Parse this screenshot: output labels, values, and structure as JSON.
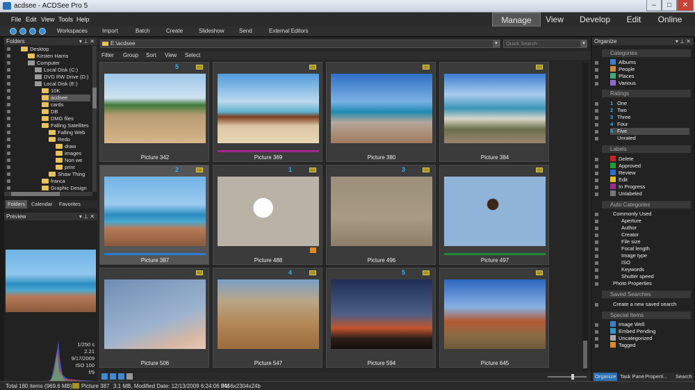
{
  "window": {
    "title": "acdsee - ACDSee Pro 5",
    "min": "–",
    "max": "□",
    "close": "✕"
  },
  "menu": [
    "File",
    "Edit",
    "View",
    "Tools",
    "Help"
  ],
  "modes": [
    "Manage",
    "View",
    "Develop",
    "Edit",
    "Online"
  ],
  "toolbar": [
    "Workspaces",
    "Import",
    "Batch",
    "Create",
    "Slideshow",
    "Send",
    "External Editors"
  ],
  "left": {
    "folders_title": "Folders",
    "tree": [
      {
        "label": "Desktop",
        "indent": 0,
        "type": "folder"
      },
      {
        "label": "Kirsten Harris",
        "indent": 1,
        "type": "folder"
      },
      {
        "label": "Computer",
        "indent": 1,
        "type": "drive"
      },
      {
        "label": "Local Disk (C:)",
        "indent": 2,
        "type": "drive"
      },
      {
        "label": "DVD RW Drive (D:)",
        "indent": 2,
        "type": "drive"
      },
      {
        "label": "Local Disk (E:)",
        "indent": 2,
        "type": "drive"
      },
      {
        "label": "10K",
        "indent": 3,
        "type": "folder"
      },
      {
        "label": "acdsee",
        "indent": 3,
        "type": "folder"
      },
      {
        "label": "cards",
        "indent": 3,
        "type": "folder"
      },
      {
        "label": "DB",
        "indent": 3,
        "type": "folder"
      },
      {
        "label": "DMG files",
        "indent": 3,
        "type": "folder"
      },
      {
        "label": "Falling Satellites",
        "indent": 3,
        "type": "folder"
      },
      {
        "label": "Falling Web",
        "indent": 4,
        "type": "folder"
      },
      {
        "label": "Redo",
        "indent": 4,
        "type": "folder"
      },
      {
        "label": "draw",
        "indent": 5,
        "type": "folder"
      },
      {
        "label": "images",
        "indent": 5,
        "type": "folder"
      },
      {
        "label": "Non we",
        "indent": 5,
        "type": "folder"
      },
      {
        "label": "print",
        "indent": 5,
        "type": "folder"
      },
      {
        "label": "Shaw Thing",
        "indent": 4,
        "type": "folder"
      },
      {
        "label": "franca",
        "indent": 3,
        "type": "folder"
      },
      {
        "label": "Graphic Design",
        "indent": 3,
        "type": "folder"
      }
    ],
    "tabs": [
      "Folders",
      "Calendar",
      "Favorites"
    ],
    "preview_title": "Preview",
    "exif": [
      "1/250 s",
      "2.21",
      "9/17/2009",
      "ISO 100",
      "f/9"
    ]
  },
  "center": {
    "path": "E:\\acdsee",
    "search_placeholder": "Quick Search",
    "filterbar": [
      "Filter",
      "Group",
      "Sort",
      "View",
      "Select"
    ],
    "thumbs": [
      {
        "caption": "Picture 342",
        "rating": "5",
        "bg": "linear-gradient(180deg,#9cc7ea 0%,#cfe2f1 35%,#3f7a3a 45%,#b99c73 60%,#d6b689 100%)",
        "color": ""
      },
      {
        "caption": "Picture 369",
        "rating": "",
        "bg": "linear-gradient(180deg,#4f9bdc 0%,#bcd9ef 40%,#5fb0cf 55%,#7a3e1f 62%,#dbc5a3 75%,#e8d6b5 100%)",
        "color": "#a0288f"
      },
      {
        "caption": "Picture 380",
        "rating": "",
        "bg": "linear-gradient(180deg,#2f6fc6 0%,#7ab1e3 40%,#1f8ab3 55%,#b4a79a 70%,#a07a5a 100%)",
        "color": ""
      },
      {
        "caption": "Picture 384",
        "rating": "",
        "bg": "linear-gradient(180deg,#3b7dd0 0%,#a9cbed 30%,#3a96b8 50%,#d9d4c6 65%,#6a6e4a 80%,#9a8670 100%)",
        "color": ""
      },
      {
        "caption": "Picture 387",
        "rating": "2",
        "bg": "linear-gradient(180deg,#6fb3e6 0%,#9ccbef 40%,#2a8cc0 55%,#4aa8cf 65%,#b77a57 75%,#8a5a3b 100%)",
        "color": "#2c7cd3",
        "sel": true
      },
      {
        "caption": "Picture 488",
        "rating": "1",
        "bg": "radial-gradient(circle at 45% 45%,#ffffff 0 14%,#b9b2a6 15% 100%)",
        "color": "",
        "tag": true
      },
      {
        "caption": "Picture 496",
        "rating": "3",
        "bg": "linear-gradient(180deg,#9c8f7b 0%,#a89a84 60%,#8c7e69 100%)",
        "color": ""
      },
      {
        "caption": "Picture 497",
        "rating": "",
        "bg": "radial-gradient(circle at 48% 40%,#3a2718 0 8%,#8fb4d8 9% 100%)",
        "color": "#1f8a3a"
      },
      {
        "caption": "Picture 506",
        "rating": "",
        "bg": "linear-gradient(160deg,#6e8db4 0%,#9db4cf 60%,#d7b7a4 85%,#e6c8b6 100%)",
        "color": ""
      },
      {
        "caption": "Picture 547",
        "rating": "4",
        "bg": "linear-gradient(180deg,#7aa0c8 0%,#b8a688 30%,#b58a5a 60%,#9b6b3d 100%)",
        "color": ""
      },
      {
        "caption": "Picture 594",
        "rating": "5",
        "bg": "linear-gradient(180deg,#1f2f58 0%,#4d5f86 50%,#c2542b 70%,#2c1d18 85%,#150f0c 100%)",
        "color": ""
      },
      {
        "caption": "Picture 645",
        "rating": "",
        "bg": "linear-gradient(180deg,#2f66c0 0%,#88b0e2 40%,#b25a34 60%,#8c6a45 80%,#6e5a3a 100%)",
        "color": ""
      }
    ]
  },
  "right": {
    "title": "Organize",
    "categories_head": "Categories",
    "categories": [
      "Albums",
      "People",
      "Places",
      "Various"
    ],
    "ratings_head": "Ratings",
    "ratings": [
      {
        "num": "1",
        "label": "One"
      },
      {
        "num": "2",
        "label": "Two"
      },
      {
        "num": "3",
        "label": "Three"
      },
      {
        "num": "4",
        "label": "Four"
      },
      {
        "num": "5",
        "label": "Five"
      },
      {
        "num": "",
        "label": "Unrated"
      }
    ],
    "labels_head": "Labels",
    "labels": [
      {
        "label": "Delete",
        "color": "#d02020"
      },
      {
        "label": "Approved",
        "color": "#20a030"
      },
      {
        "label": "Review",
        "color": "#2a6fd0"
      },
      {
        "label": "Edit",
        "color": "#e0c020"
      },
      {
        "label": "In Progress",
        "color": "#a0288f"
      },
      {
        "label": "Unlabeled",
        "color": "#777777"
      }
    ],
    "auto_head": "Auto Categories",
    "auto_group": "Commonly Used",
    "auto_items": [
      "Aperture",
      "Author",
      "Creator",
      "File size",
      "Focal length",
      "Image type",
      "ISO",
      "Keywords",
      "Shutter speed"
    ],
    "photo_props": "Photo Properties",
    "saved_head": "Saved Searches",
    "saved_new": "Create a new saved search",
    "special_head": "Special Items",
    "special": [
      "Image Well",
      "Embed Pending",
      "Uncategorized",
      "Tagged"
    ],
    "tabs": [
      "Organize",
      "Task Pane",
      "Properti...",
      "Search"
    ]
  },
  "status": {
    "total": "Total 180 items  (969.6 MB)",
    "current": "Picture 387",
    "info": "3.1 MB, Modified Date: 12/13/2009 6:24:06 PM",
    "dims": "3456x2304x24b"
  }
}
